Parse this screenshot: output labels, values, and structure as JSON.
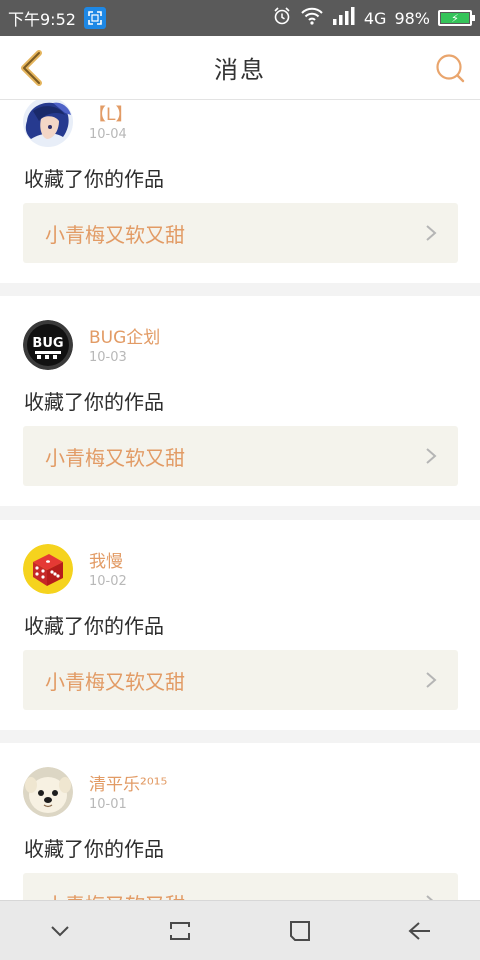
{
  "status_bar": {
    "time": "下午9:52",
    "network": "4G",
    "battery": "98%"
  },
  "header": {
    "title": "消息"
  },
  "messages": [
    {
      "username": "【L】",
      "date": "10-04",
      "action": "收藏了你的作品",
      "work_title": "小青梅又软又甜"
    },
    {
      "username": "BUG企划",
      "date": "10-03",
      "action": "收藏了你的作品",
      "work_title": "小青梅又软又甜",
      "avatar_text": "BUG"
    },
    {
      "username": "我慢",
      "date": "10-02",
      "action": "收藏了你的作品",
      "work_title": "小青梅又软又甜"
    },
    {
      "username": "清平乐²⁰¹⁵",
      "date": "10-01",
      "action": "收藏了你的作品",
      "work_title": "小青梅又软又甜"
    }
  ],
  "colors": {
    "accent": "#e29b65",
    "status_bar": "#5a5a5a",
    "link_background": "#f4f3ec"
  },
  "icons": {
    "back": "back-chevron-icon",
    "search": "search-icon",
    "screenshot": "screenshot-icon",
    "work_link": "chevron-right-icon",
    "nav_down": "chevron-down-icon",
    "nav_recent": "recent-apps-icon",
    "nav_home": "home-icon",
    "nav_back": "back-arrow-icon"
  }
}
